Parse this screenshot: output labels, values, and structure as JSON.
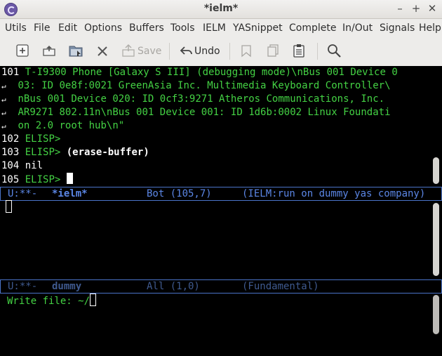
{
  "window": {
    "title": "*ielm*"
  },
  "menu": [
    "Utils",
    "File",
    "Edit",
    "Options",
    "Buffers",
    "Tools",
    "IELM",
    "YASnippet",
    "Complete",
    "In/Out",
    "Signals",
    "Help"
  ],
  "toolbar": {
    "save_label": "Save",
    "undo_label": "Undo"
  },
  "top_buffer": {
    "lines": [
      {
        "num": "101",
        "text": "T-I9300 Phone [Galaxy S III] (debugging mode)\\nBus 001 Device 0"
      },
      {
        "num": "",
        "text": "03: ID 0e8f:0021 GreenAsia Inc. Multimedia Keyboard Controller\\"
      },
      {
        "num": "",
        "text": "nBus 001 Device 020: ID 0cf3:9271 Atheros Communications, Inc. "
      },
      {
        "num": "",
        "text": "AR9271 802.11n\\nBus 001 Device 001: ID 1d6b:0002 Linux Foundati"
      },
      {
        "num": "",
        "text": "on 2.0 root hub\\n\""
      },
      {
        "num": "102",
        "prompt": "ELISP>"
      },
      {
        "num": "103",
        "prompt": "ELISP>",
        "input": "(erase-buffer)"
      },
      {
        "num": "104",
        "result": "nil"
      },
      {
        "num": "105",
        "prompt": "ELISP>"
      }
    ],
    "modeline": {
      "status": "U:**-",
      "name": "*ielm*",
      "position": "Bot (105,7)",
      "mode": "(IELM:run on dummy yas company)"
    }
  },
  "bottom_buffer": {
    "modeline": {
      "status": "U:**-",
      "name": "dummy",
      "position": "All (1,0)",
      "mode": "(Fundamental)"
    }
  },
  "minibuffer": {
    "prompt": "Write file: ~/"
  }
}
